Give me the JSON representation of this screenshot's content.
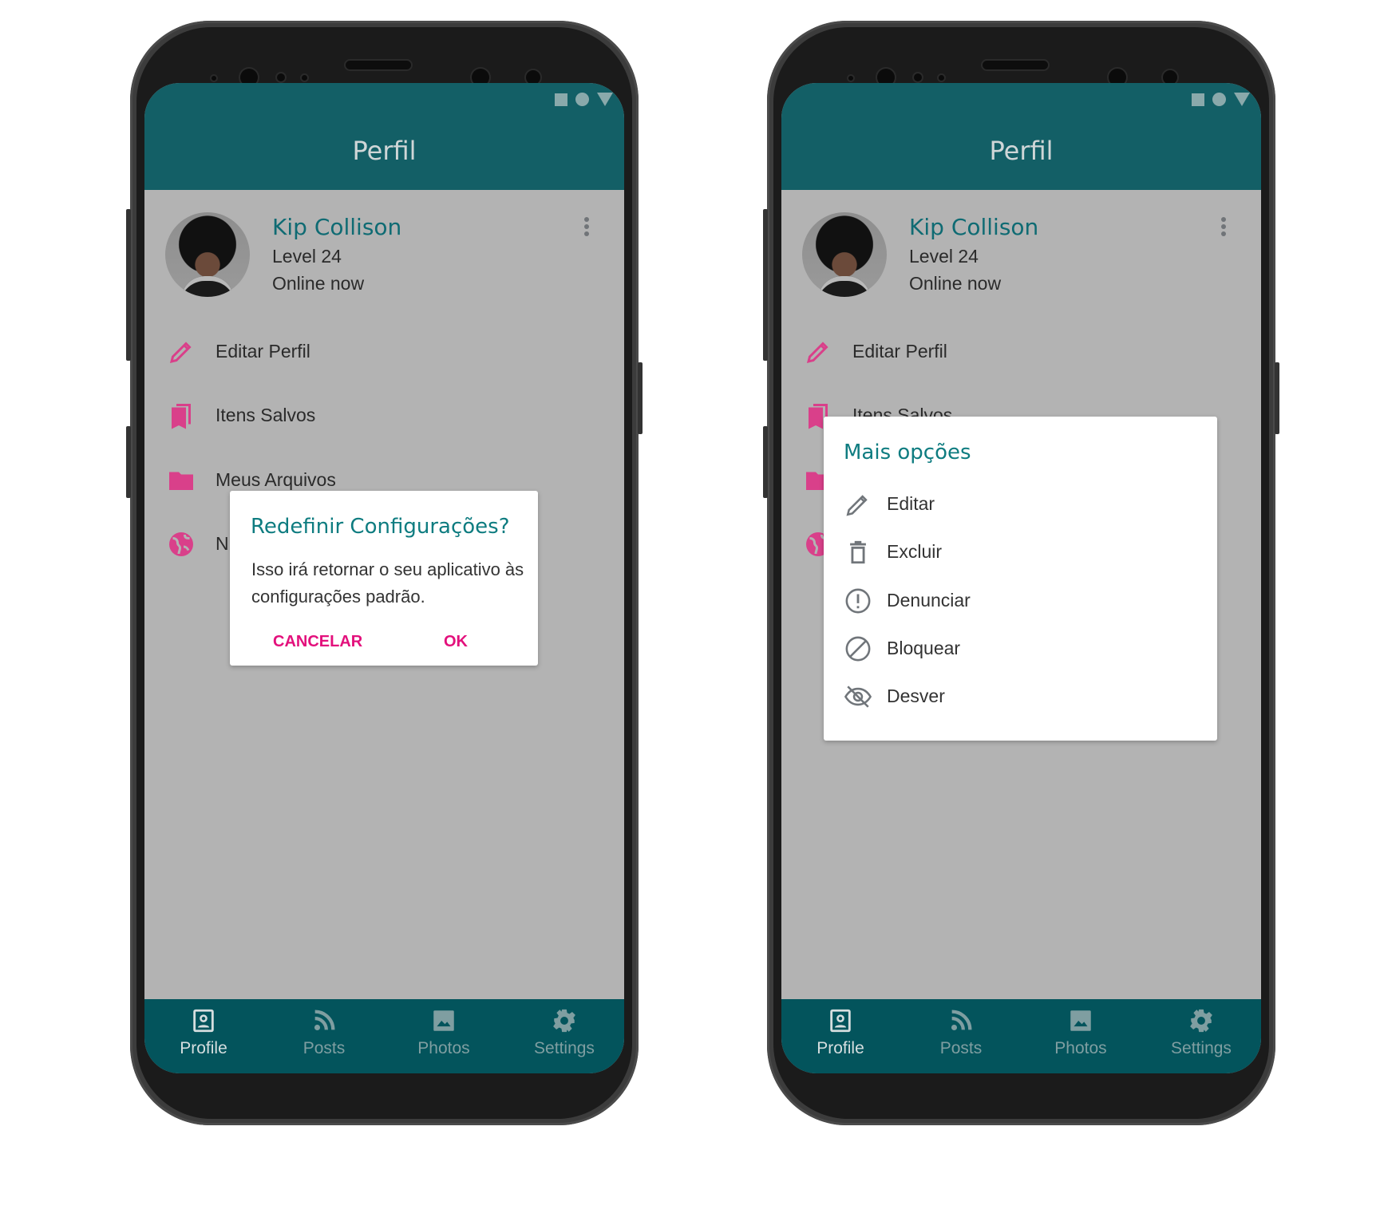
{
  "colors": {
    "header": "#135f66",
    "accent_teal": "#0e7c80",
    "accent_pink": "#e3107c",
    "icon_pink": "#d9408a",
    "nav": "#03545c",
    "scrim": "#b3b3b3"
  },
  "status_icons": [
    "square-icon",
    "circle-icon",
    "triangle-icon"
  ],
  "header": {
    "title": "Perfil"
  },
  "profile": {
    "name": "Kip Collison",
    "level": "Level 24",
    "status": "Online now"
  },
  "menu": [
    {
      "label": "Editar Perfil",
      "icon": "pencil-icon"
    },
    {
      "label": "Itens Salvos",
      "icon": "bookmarks-icon"
    },
    {
      "label": "Meus Arquivos",
      "icon": "folder-icon"
    },
    {
      "label": "N",
      "icon": "globe-icon"
    }
  ],
  "dialog": {
    "title": "Redefinir Configurações?",
    "body": "Isso irá retornar o seu aplicativo às configurações padrão.",
    "cancel": "CANCELAR",
    "ok": "OK"
  },
  "options": {
    "title": "Mais opções",
    "items": [
      {
        "label": "Editar",
        "icon": "pencil-icon"
      },
      {
        "label": "Excluir",
        "icon": "trash-icon"
      },
      {
        "label": "Denunciar",
        "icon": "alert-circle-icon"
      },
      {
        "label": "Bloquear",
        "icon": "block-icon"
      },
      {
        "label": "Desver",
        "icon": "eye-off-icon"
      }
    ]
  },
  "nav": [
    {
      "label": "Profile",
      "icon": "profile-icon",
      "active": true
    },
    {
      "label": "Posts",
      "icon": "rss-icon"
    },
    {
      "label": "Photos",
      "icon": "image-icon"
    },
    {
      "label": "Settings",
      "icon": "gear-icon"
    }
  ]
}
